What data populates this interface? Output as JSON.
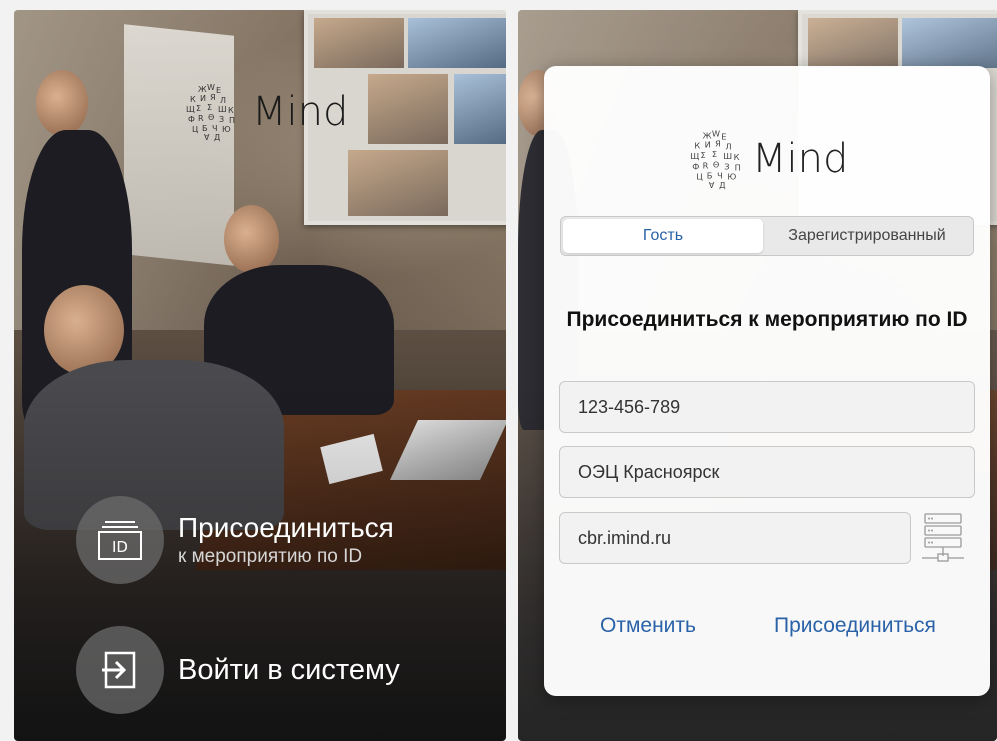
{
  "brand": {
    "name": "Mind"
  },
  "left": {
    "join": {
      "title": "Присоединиться",
      "subtitle": "к мероприятию по ID",
      "icon_label": "ID"
    },
    "login": {
      "title": "Войти в систему"
    }
  },
  "dialog": {
    "tabs": [
      {
        "label": "Гость",
        "active": true
      },
      {
        "label": "Зарегистрированный",
        "active": false
      }
    ],
    "title": "Присоединиться к мероприятию по ID",
    "fields": {
      "conference_id": "123-456-789",
      "display_name": "ОЭЦ Красноярск",
      "server": "cbr.imind.ru"
    },
    "buttons": {
      "cancel": "Отменить",
      "join": "Присоединиться"
    }
  },
  "colors": {
    "accent": "#2a62a8",
    "overlay_circle": "#6e6e6e"
  },
  "icons": [
    "mind-logo-cube-icon",
    "id-card-icon",
    "login-arrow-icon",
    "server-list-icon"
  ]
}
